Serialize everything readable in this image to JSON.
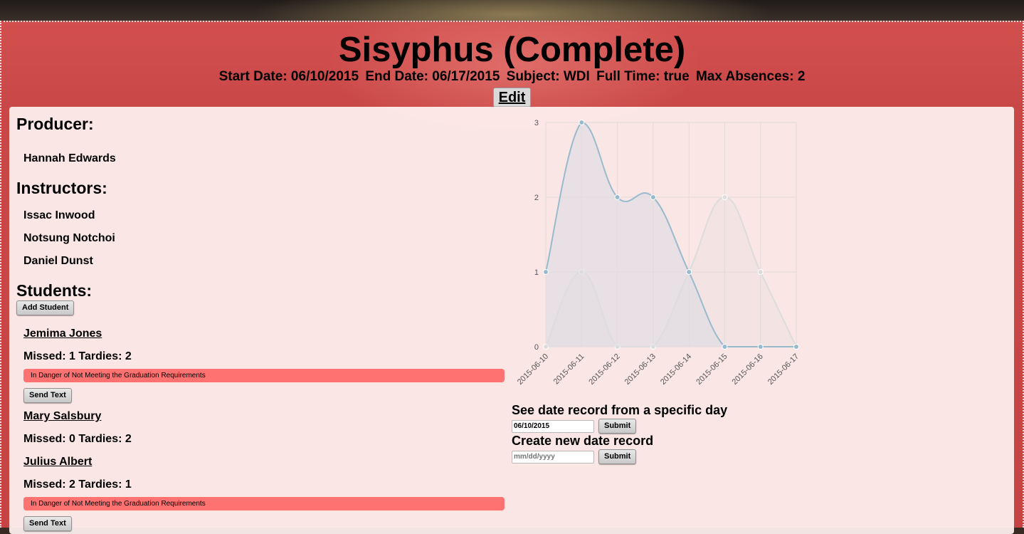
{
  "header": {
    "title": "Sisyphus (Complete)",
    "start_date_label": "Start Date: 06/10/2015",
    "end_date_label": "End Date: 06/17/2015",
    "subject_label": "Subject: WDI",
    "full_time_label": "Full Time: true",
    "max_absences_label": "Max Absences: 2",
    "edit_label": "Edit"
  },
  "producer": {
    "heading": "Producer:",
    "name": "Hannah Edwards"
  },
  "instructors": {
    "heading": "Instructors:",
    "names": [
      "Issac Inwood",
      "Notsung Notchoi",
      "Daniel Dunst"
    ]
  },
  "students": {
    "heading": "Students:",
    "add_label": "Add Student",
    "list": [
      {
        "name": "Jemima Jones",
        "stats": "Missed: 1 Tardies: 2",
        "warning": "In Danger of Not Meeting the Graduation Requirements",
        "text_label": "Send Text"
      },
      {
        "name": "Mary Salsbury",
        "stats": "Missed: 0 Tardies: 2"
      },
      {
        "name": "Julius Albert",
        "stats": "Missed: 2 Tardies: 1",
        "warning": "In Danger of Not Meeting the Graduation Requirements",
        "text_label": "Send Text"
      }
    ]
  },
  "forms": {
    "see_title": "See date record from a specific day",
    "see_value": "06/10/2015",
    "see_submit": "Submit",
    "create_title": "Create new date record",
    "create_placeholder": "mm/dd/yyyy",
    "create_submit": "Submit"
  },
  "chart_data": {
    "type": "line",
    "x": [
      "2015-06-10",
      "2015-06-11",
      "2015-06-12",
      "2015-06-13",
      "2015-06-14",
      "2015-06-15",
      "2015-06-16",
      "2015-06-17"
    ],
    "series": [
      {
        "values": [
          1,
          3,
          2,
          2,
          1,
          0,
          0,
          0
        ],
        "color": "#97bbcd",
        "fill": "rgba(220,220,228,0.6)"
      },
      {
        "values": [
          0,
          1,
          0,
          0,
          1,
          2,
          1,
          0
        ],
        "color": "#dcdcdc",
        "fill": "rgba(220,220,220,0.25)"
      }
    ],
    "ylim": [
      0,
      3
    ],
    "yticks": [
      0,
      1,
      2,
      3
    ],
    "grid": true
  }
}
